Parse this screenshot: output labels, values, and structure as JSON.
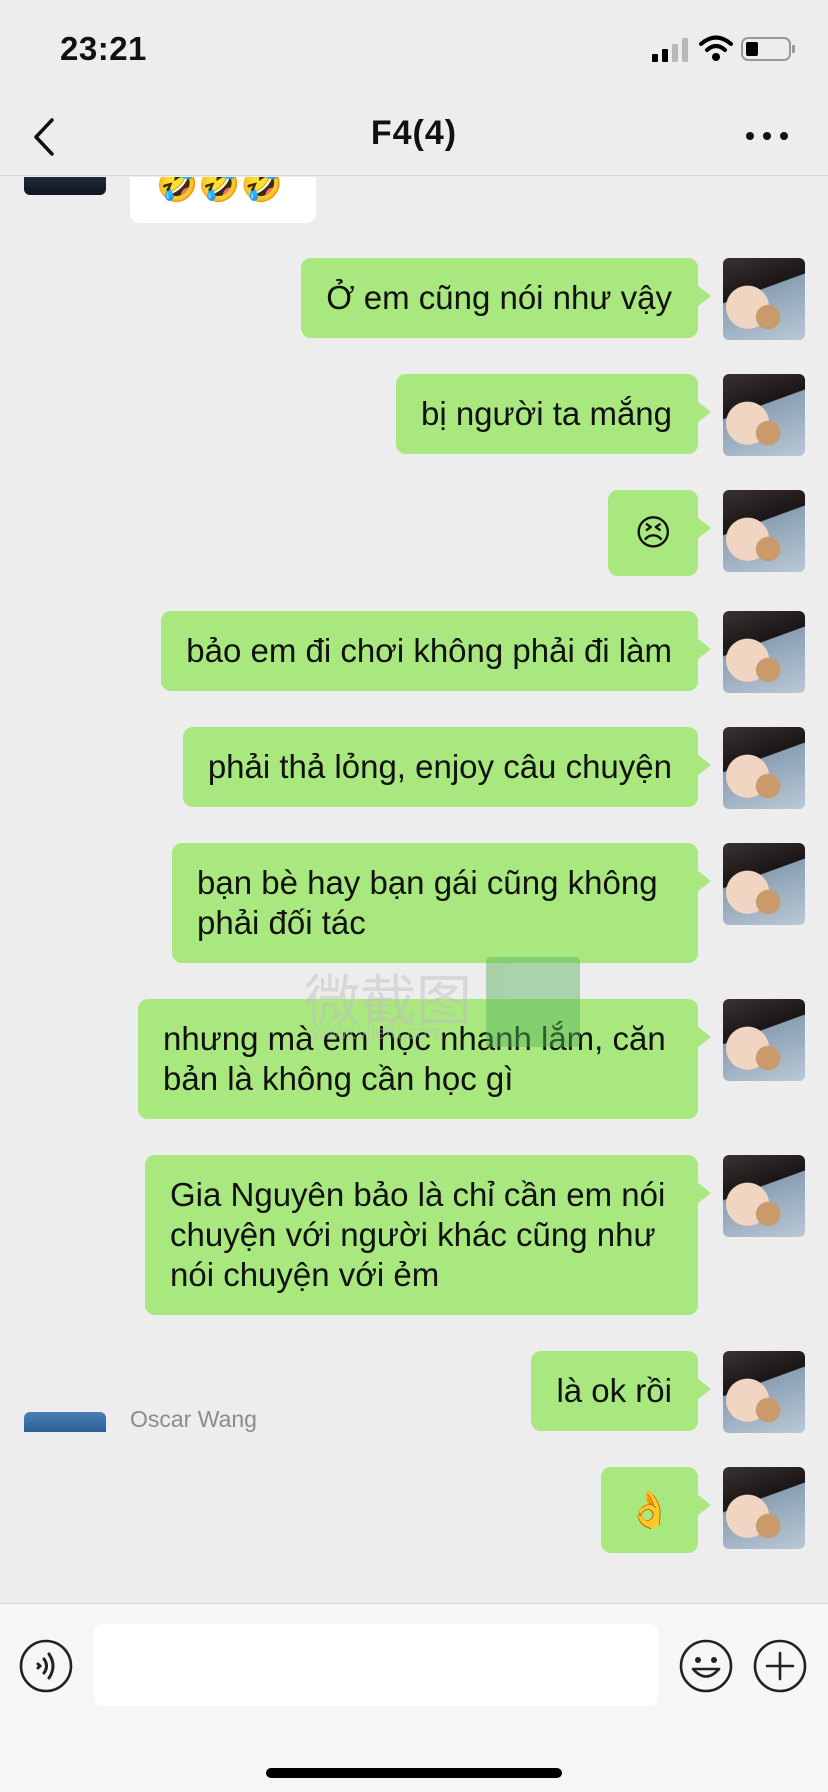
{
  "status": {
    "time": "23:21"
  },
  "nav": {
    "title": "F4(4)"
  },
  "chat": {
    "top_partial_message": "🤣🤣🤣",
    "messages": [
      {
        "text": "Ở em cũng nói như vậy"
      },
      {
        "text": "bị người ta mắng"
      },
      {
        "text": "😣"
      },
      {
        "text": "bảo em đi chơi không phải đi làm"
      },
      {
        "text": "phải thả lỏng, enjoy câu chuyện"
      },
      {
        "text": "bạn bè hay bạn gái cũng không phải đối tác"
      },
      {
        "text": "nhưng mà em học nhanh lắm, căn bản là không cần học gì"
      },
      {
        "text": "Gia Nguyên bảo là chỉ cần em nói chuyện với người khác cũng như nói chuyện với ẻm"
      },
      {
        "text": "là ok rồi"
      },
      {
        "text": "👌"
      }
    ],
    "next_sender": "Oscar Wang"
  },
  "watermark": {
    "text": "微截图",
    "url": "www.vjietu.com"
  },
  "input": {
    "value": ""
  },
  "colors": {
    "bubble_self": "#a9e87e",
    "background": "#ededed"
  }
}
